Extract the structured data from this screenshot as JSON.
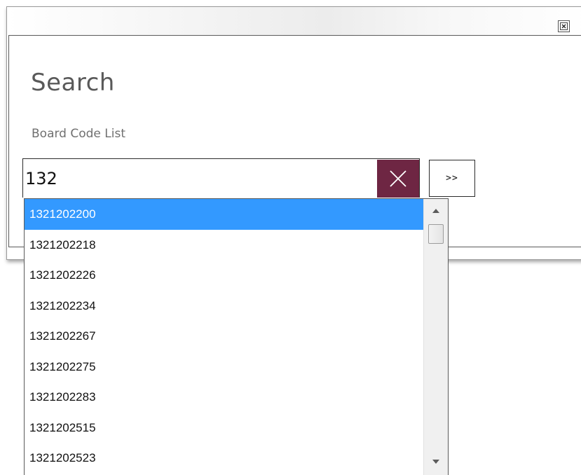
{
  "window": {
    "close_icon": "close-box-icon"
  },
  "form": {
    "title": "Search",
    "field_label": "Board Code List",
    "search_value": "132",
    "clear_icon": "x-icon",
    "clear_color": "#6e2643",
    "go_label": ">>"
  },
  "dropdown": {
    "selected_index": 0,
    "highlight_color": "#3399ff",
    "items": [
      "1321202200",
      "1321202218",
      "1321202226",
      "1321202234",
      "1321202267",
      "1321202275",
      "1321202283",
      "1321202515",
      "1321202523"
    ],
    "scrollbar": {
      "up_icon": "scroll-up-arrow-icon",
      "down_icon": "scroll-down-arrow-icon"
    }
  }
}
